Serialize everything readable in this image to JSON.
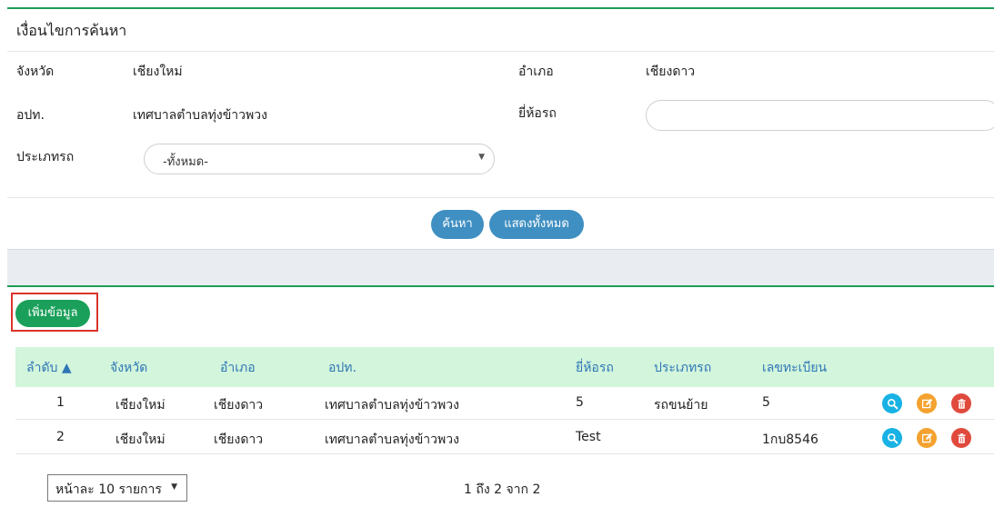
{
  "search": {
    "title": "เงื่อนไขการค้นหา",
    "province_label": "จังหวัด",
    "province_value": "เชียงใหม่",
    "district_label": "อำเภอ",
    "district_value": "เชียงดาว",
    "org_label": "อปท.",
    "org_value": "เทศบาลตำบลทุ่งข้าวพวง",
    "brand_label": "ยี่ห้อรถ",
    "brand_input_value": "",
    "type_label": "ประเภทรถ",
    "type_selected": "-ทั้งหมด-",
    "search_button": "ค้นหา",
    "show_all_button": "แสดงทั้งหมด"
  },
  "actions": {
    "add_button": "เพิ่มข้อมูล"
  },
  "table": {
    "headers": [
      "ลำดับ ▲",
      "จังหวัด",
      "อำเภอ",
      "อปท.",
      "ยี่ห้อรถ",
      "ประเภทรถ",
      "เลขทะเบียน"
    ],
    "rows": [
      [
        "1",
        "เชียงใหม่",
        "เชียงดาว",
        "เทศบาลตำบลทุ่งข้าวพวง",
        "5",
        "รถขนย้าย",
        "5"
      ],
      [
        "2",
        "เชียงใหม่",
        "เชียงดาว",
        "เทศบาลตำบลทุ่งข้าวพวง",
        "Test",
        "",
        "1กบ8546"
      ]
    ],
    "row_actions": [
      "search-icon",
      "edit-icon",
      "trash-icon"
    ]
  },
  "pagination": {
    "page_size_selected": "หน้าละ 10 รายการ",
    "info": "1 ถึง 2 จาก 2"
  },
  "colors": {
    "accent_green": "#1e9c58",
    "button_blue": "#3f8fc2",
    "header_bg": "#d2f5dc",
    "header_text": "#2f76b5"
  }
}
